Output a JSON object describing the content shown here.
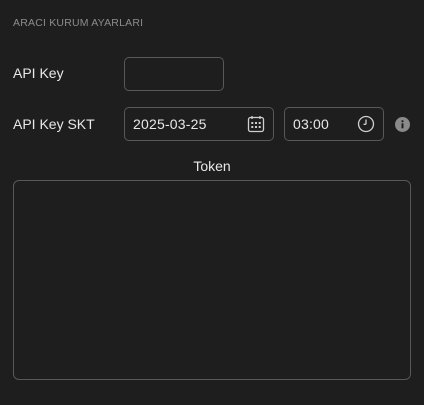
{
  "section": {
    "title": "ARACI KURUM AYARLARI"
  },
  "api_key": {
    "label": "API Key",
    "value": "",
    "placeholder": ""
  },
  "api_key_skt": {
    "label": "API Key SKT",
    "date_value": "2025-03-25",
    "time_value": "03:00",
    "date_icon": "calendar-icon",
    "time_icon": "clock-icon",
    "info_icon": "info-icon"
  },
  "token": {
    "label": "Token",
    "value": ""
  },
  "colors": {
    "background": "#1e1e1e",
    "border": "#585858",
    "text": "#e8e8e8",
    "muted_text": "#8c8c8c",
    "info_icon": "#8a8a8a"
  }
}
